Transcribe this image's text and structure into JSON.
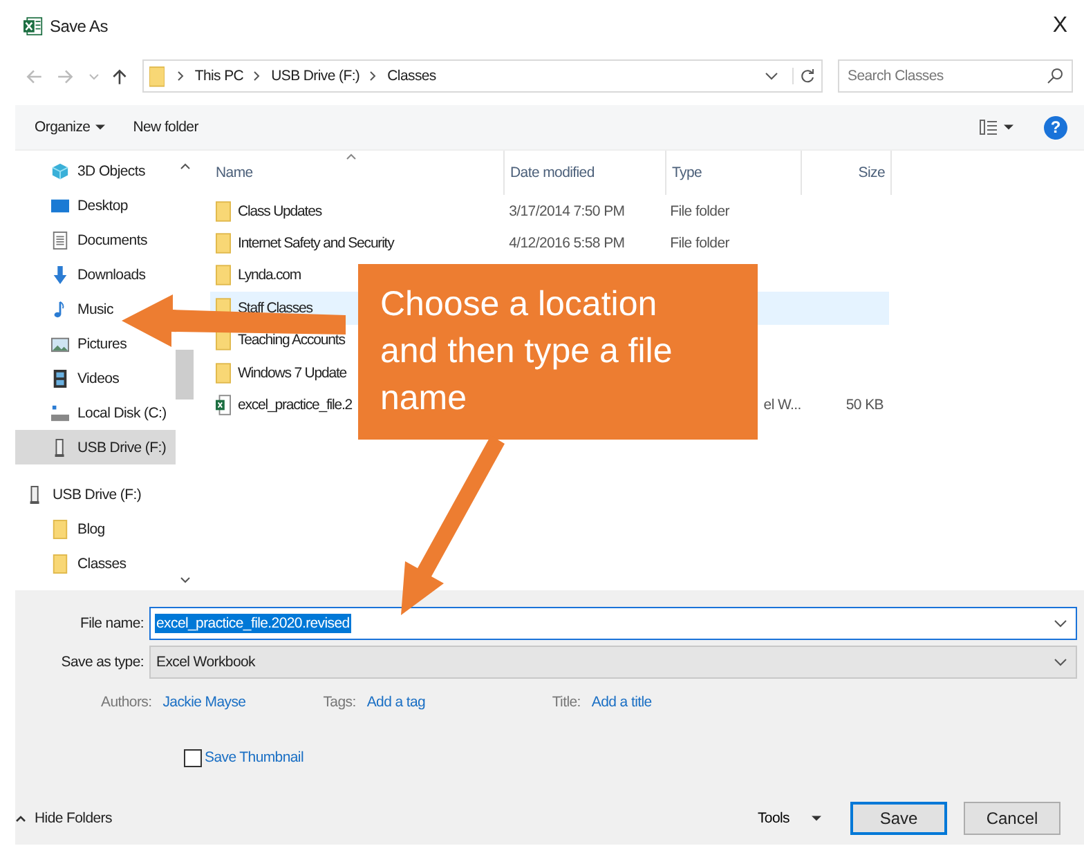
{
  "window": {
    "title": "Save As",
    "close": "X"
  },
  "address_bar": {
    "crumbs": [
      "This PC",
      "USB Drive (F:)",
      "Classes"
    ]
  },
  "search": {
    "placeholder": "Search Classes"
  },
  "toolbar": {
    "organize": "Organize",
    "new_folder": "New folder",
    "help": "?"
  },
  "sidebar": {
    "items": [
      {
        "label": "3D Objects",
        "selected": false
      },
      {
        "label": "Desktop",
        "selected": false
      },
      {
        "label": "Documents",
        "selected": false
      },
      {
        "label": "Downloads",
        "selected": false
      },
      {
        "label": "Music",
        "selected": false
      },
      {
        "label": "Pictures",
        "selected": false
      },
      {
        "label": "Videos",
        "selected": false
      },
      {
        "label": "Local Disk (C:)",
        "selected": false
      },
      {
        "label": "USB Drive (F:)",
        "selected": true
      },
      {
        "label": "USB Drive (F:)",
        "selected": false
      },
      {
        "label": "Blog",
        "selected": false
      },
      {
        "label": "Classes",
        "selected": false
      }
    ]
  },
  "table": {
    "columns": [
      "Name",
      "Date modified",
      "Type",
      "Size"
    ],
    "rows": [
      {
        "kind": "folder",
        "name": "Class Updates",
        "date": "3/17/2014 7:50 PM",
        "type": "File folder",
        "selected": false
      },
      {
        "kind": "folder",
        "name": "Internet Safety and Security",
        "date": "4/12/2016 5:58 PM",
        "type": "File folder",
        "selected": false
      },
      {
        "kind": "folder",
        "name": "Lynda.com",
        "selected": false
      },
      {
        "kind": "folder",
        "name": "Staff Classes",
        "selected": true
      },
      {
        "kind": "folder",
        "name": "Teaching Accounts",
        "selected": false
      },
      {
        "kind": "folder",
        "name": "Windows 7 Update",
        "selected": false
      },
      {
        "kind": "file",
        "name": "excel_practice_file.2",
        "type": "el W...",
        "size": "50 KB",
        "selected": false
      }
    ]
  },
  "callout": {
    "text": "Choose a location and then type a file name"
  },
  "form": {
    "file_name_label": "File name:",
    "file_name": "excel_practice_file.2020.revised",
    "type_label": "Save as type:",
    "type_value": "Excel Workbook",
    "authors_label": "Authors:",
    "authors": "Jackie Mayse",
    "tags_label": "Tags:",
    "tags": "Add a tag",
    "title_label": "Title:",
    "title": "Add a title",
    "thumbnail": {
      "label": "Save Thumbnail",
      "checked": false
    }
  },
  "footer": {
    "hide_folders": "Hide Folders",
    "tools": "Tools",
    "save": "Save",
    "cancel": "Cancel"
  }
}
